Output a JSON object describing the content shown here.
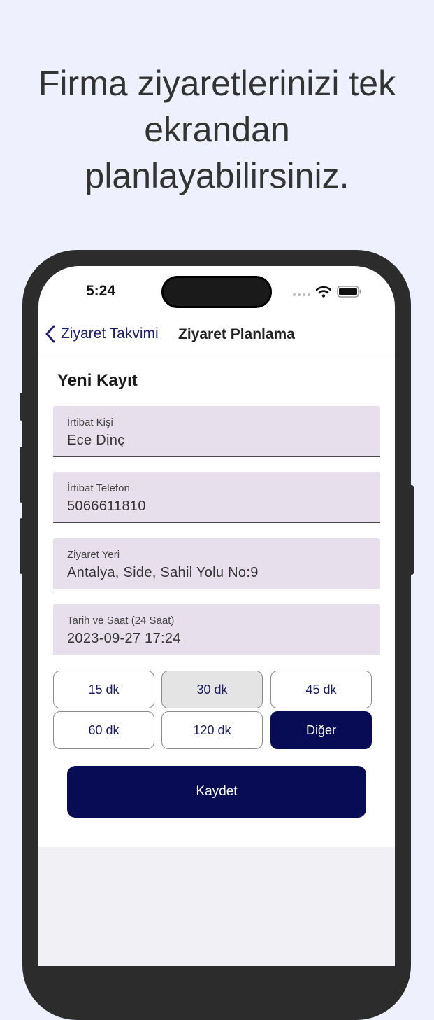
{
  "headline": {
    "line1": "Firma ziyaretlerinizi tek",
    "line2": "ekrandan",
    "line3": "planlayabilirsiniz."
  },
  "status_bar": {
    "time": "5:24"
  },
  "nav": {
    "back_label": "Ziyaret Takvimi",
    "title": "Ziyaret Planlama"
  },
  "form": {
    "section_title": "Yeni Kayıt",
    "fields": [
      {
        "label": "İrtibat Kişi",
        "value": "Ece Dinç"
      },
      {
        "label": "İrtibat Telefon",
        "value": "5066611810"
      },
      {
        "label": "Ziyaret Yeri",
        "value": "Antalya, Side, Sahil Yolu No:9"
      },
      {
        "label": "Tarih ve Saat (24 Saat)",
        "value": "2023-09-27 17:24"
      }
    ],
    "durations": [
      "15 dk",
      "30 dk",
      "45 dk",
      "60 dk",
      "120 dk",
      "Diğer"
    ],
    "selected_duration": "30 dk",
    "save_label": "Kaydet"
  },
  "colors": {
    "background": "#eef0fd",
    "navy": "#070c55",
    "field_bg": "#e7e0ec",
    "accent_text": "#1e1e6e"
  }
}
